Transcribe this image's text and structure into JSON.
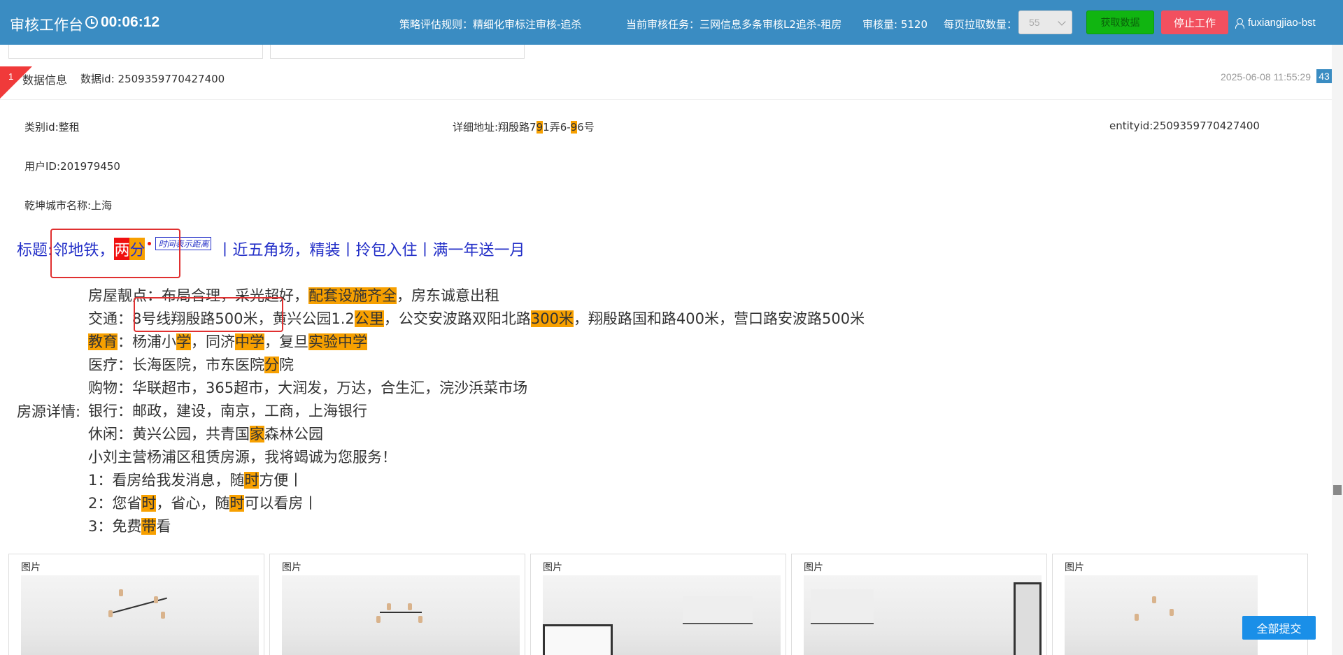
{
  "header": {
    "title": "审核工作台",
    "timer": "00:06:12",
    "rule_label": "策略评估规则：",
    "rule_value": "精细化审标注审核-追杀",
    "task_label": "当前审核任务：",
    "task_value": "三网信息多条审核L2追杀-租房",
    "review_count_label": "审核量:",
    "review_count": "5120",
    "per_page_label": "每页拉取数量：",
    "per_page_value": "55",
    "fetch_button": "获取数据",
    "stop_button": "停止工作",
    "username": "fuxiangjiao-bst"
  },
  "record": {
    "index": "1",
    "section_label": "数据信息",
    "data_id_label": "数据id:",
    "data_id": "2509359770427400",
    "timestamp": "2025-06-08 11:55:29",
    "badge": "43",
    "category": "类别id:整租",
    "address_prefix": "详细地址:翔殷路7",
    "address_hl1": "9",
    "address_mid": "1弄6-",
    "address_hl2": "9",
    "address_suffix": "6号",
    "entity": "entityid:2509359770427400",
    "user_id": "用户ID:201979450",
    "city": "乾坤城市名称:上海",
    "title": {
      "label": "标题:",
      "part1": "邻地铁，",
      "part_red": "两",
      "part_orange": "分",
      "tip": "时间表示距离",
      "part2": "丨近五角场，精装丨拎包入住丨满一年送一月"
    },
    "detail_label": "房源详情:",
    "lines": {
      "l1_a": "房屋靓点：布局合理，采光超好，",
      "l1_hl": "配套设施齐全",
      "l1_b": "，房东诚意出租",
      "l2_a": "交通：8号线翔殷路500米，黄兴公园1.2",
      "l2_hl1": "公里",
      "l2_b": "，公交安波路双阳北路",
      "l2_hl2": "300米",
      "l2_c": "，翔殷路国和路400米，营口路安波路500米",
      "l3_hl1": "教育",
      "l3_a": "：杨浦小",
      "l3_hl2": "学",
      "l3_b": "，同济",
      "l3_hl3": "中学",
      "l3_c": "，复旦",
      "l3_hl4": "实验中学",
      "l4_a": "医疗：长海医院，市东医院",
      "l4_hl": "分",
      "l4_b": "院",
      "l5": "购物：华联超市，365超市，大润发，万达，合生汇，浣沙浜菜市场",
      "l6": "银行：邮政，建设，南京，工商，上海银行",
      "l7_a": "休闲：黄兴公园，共青国",
      "l7_hl": "家",
      "l7_b": "森林公园",
      "l8": "小刘主营杨浦区租赁房源，我将竭诚为您服务！",
      "l9_a": "1：看房给我发消息，随",
      "l9_hl": "时",
      "l9_b": "方便丨",
      "l10_a": "2：您省",
      "l10_hl": "时",
      "l10_b": "，省心，随",
      "l10_hl2": "时",
      "l10_c": "可以看房丨",
      "l11_a": "3：免费",
      "l11_hl": "带",
      "l11_b": "看"
    },
    "image_label": "图片",
    "submit_button": "全部提交"
  }
}
